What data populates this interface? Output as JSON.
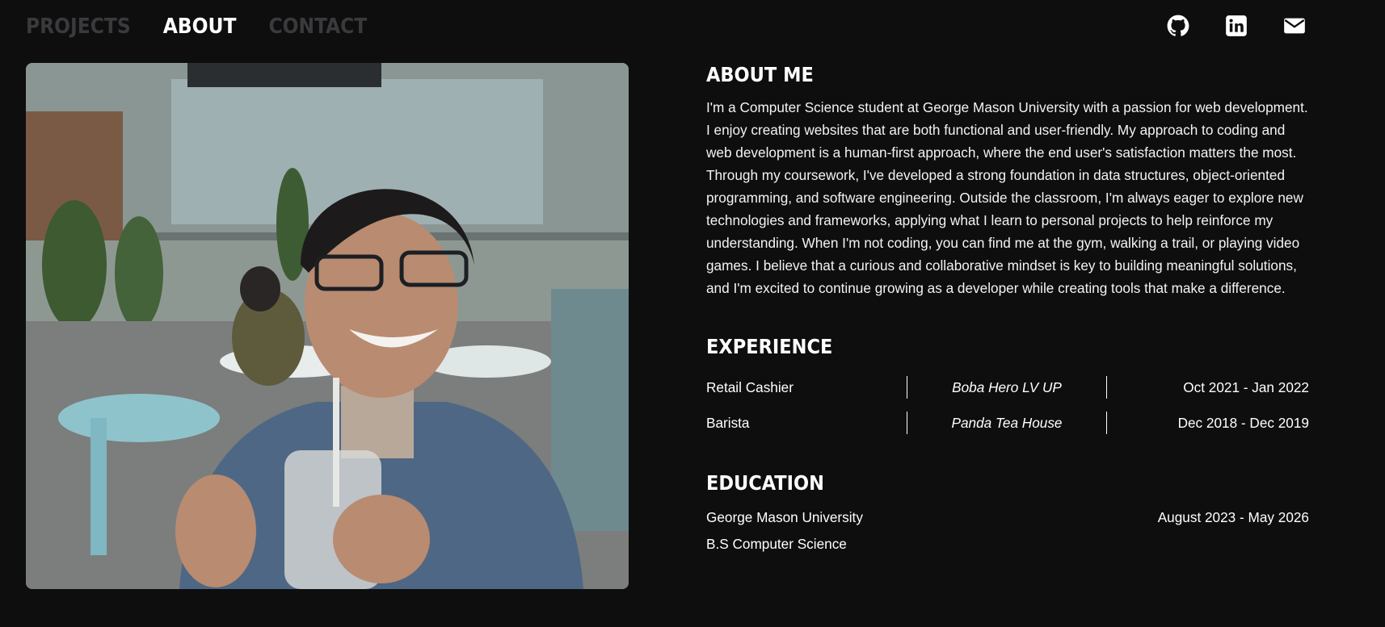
{
  "nav": {
    "items": [
      {
        "label": "PROJECTS",
        "active": false
      },
      {
        "label": "ABOUT",
        "active": true
      },
      {
        "label": "CONTACT",
        "active": false
      }
    ]
  },
  "social": [
    {
      "icon": "github-icon"
    },
    {
      "icon": "linkedin-icon"
    },
    {
      "icon": "mail-icon"
    }
  ],
  "about": {
    "title": "ABOUT ME",
    "text": "I'm a Computer Science student at George Mason University with a passion for web development. I enjoy creating websites that are both functional and user-friendly. My approach to coding and web development is a human-first approach, where the end user's satisfaction matters the most. Through my coursework, I've developed a strong foundation in data structures, object-oriented programming, and software engineering. Outside the classroom, I'm always eager to explore new technologies and frameworks, applying what I learn to personal projects to help reinforce my understanding. When I'm not coding, you can find me at the gym, walking a trail, or playing video games. I believe that a curious and collaborative mindset is key to building meaningful solutions, and I'm excited to continue growing as a developer while creating tools that make a difference."
  },
  "experience": {
    "title": "EXPERIENCE",
    "rows": [
      {
        "role": "Retail Cashier",
        "company": "Boba Hero LV UP",
        "dates": "Oct 2021 - Jan 2022"
      },
      {
        "role": "Barista",
        "company": "Panda Tea House",
        "dates": "Dec 2018 - Dec 2019"
      }
    ]
  },
  "education": {
    "title": "EDUCATION",
    "school": "George Mason University",
    "dates": "August 2023 - May 2026",
    "degree": "B.S Computer Science"
  },
  "colors": {
    "background": "#0e0e0f",
    "nav_inactive": "#3a3a3d",
    "text": "#ffffff"
  }
}
